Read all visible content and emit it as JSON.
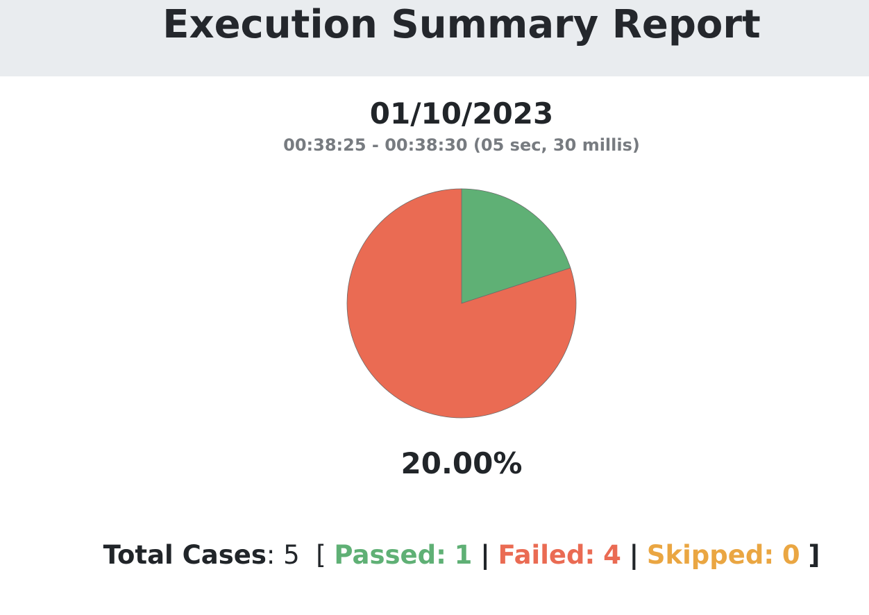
{
  "header": {
    "title": "Execution Summary Report"
  },
  "run": {
    "date": "01/10/2023",
    "time_range": "00:38:25 - 00:38:30 (05 sec, 30 millis)",
    "pass_percentage": "20.00%"
  },
  "summary": {
    "total_label": "Total Cases",
    "total_sep": ":",
    "total_value": "5",
    "open_bracket": "[",
    "passed_label": "Passed:",
    "passed_value": "1",
    "divider": "|",
    "failed_label": "Failed:",
    "failed_value": "4",
    "skipped_label": "Skipped:",
    "skipped_value": "0",
    "close_bracket": "]"
  },
  "colors": {
    "passed": "#5fb075",
    "failed": "#ea6b53",
    "skipped": "#eaa642",
    "header_bg": "#e9ecef"
  },
  "chart_data": {
    "type": "pie",
    "categories": [
      "Passed",
      "Failed",
      "Skipped"
    ],
    "values": [
      1,
      4,
      0
    ],
    "colors": [
      "#5fb075",
      "#ea6b53",
      "#eaa642"
    ]
  }
}
